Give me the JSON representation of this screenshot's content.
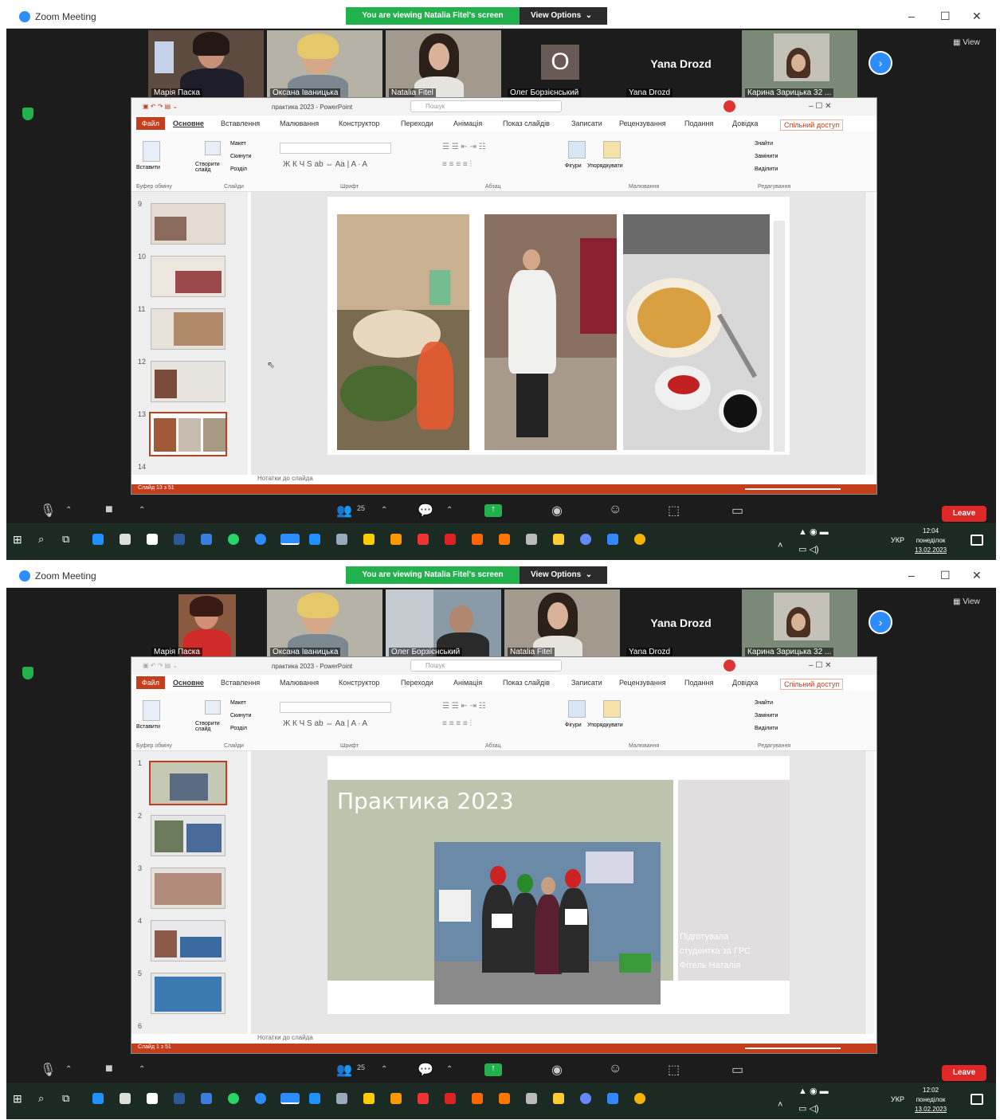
{
  "app_title": "Zoom Meeting",
  "viewing_banner": "You are viewing Natalia Fitel's screen",
  "view_options": "View Options",
  "view_button": "View",
  "leave_button": "Leave",
  "screenshots": [
    {
      "participants": [
        {
          "name": "Марія Паска"
        },
        {
          "name": "Оксана Іваницька"
        },
        {
          "name": "Natalia Fitel"
        },
        {
          "name": "Олег Борзієнський",
          "avatar": "О"
        },
        {
          "name": "Yana Drozd",
          "big_name": "Yana Drozd"
        },
        {
          "name": "Карина Зарицька 32 ..."
        }
      ],
      "ppt": {
        "title": "практика 2023 - PowerPoint",
        "search_placeholder": "Пошук",
        "file_tab": "Файл",
        "tabs": [
          "Основне",
          "Вставлення",
          "Малювання",
          "Конструктор",
          "Переходи",
          "Анімація",
          "Показ слайдів",
          "Записати",
          "Рецензування",
          "Подання",
          "Довідка"
        ],
        "share": "Спільний доступ",
        "ribbon_groups": [
          "Буфер обміну",
          "Слайди",
          "Шрифт",
          "Абзац",
          "Малювання",
          "Редагування"
        ],
        "ribbon_buttons": {
          "paste": "Вставити",
          "new_slide": "Створити слайд",
          "layout": "Макет",
          "reset": "Скинути",
          "section": "Розділ",
          "shapes": "Фігури",
          "arrange": "Упорядкувати",
          "find": "Знайти",
          "replace": "Замінити",
          "select": "Виділити"
        },
        "slide_numbers": [
          "9",
          "10",
          "11",
          "12",
          "13",
          "14"
        ],
        "selected_index": 4,
        "notes_placeholder": "Нотатки до слайда",
        "status_left": "Слайд 13 з 51"
      },
      "clock": {
        "time": "12:04",
        "day": "понеділок",
        "date": "13.02.2023"
      }
    },
    {
      "participants": [
        {
          "name": "Марія Паска"
        },
        {
          "name": "Оксана Іваницька"
        },
        {
          "name": "Олег Борзієнський"
        },
        {
          "name": "Natalia Fitel"
        },
        {
          "name": "Yana Drozd",
          "big_name": "Yana Drozd"
        },
        {
          "name": "Карина Зарицька 32 ..."
        }
      ],
      "ppt": {
        "title": "практика 2023 - PowerPoint",
        "search_placeholder": "Пошук",
        "file_tab": "Файл",
        "tabs": [
          "Основне",
          "Вставлення",
          "Малювання",
          "Конструктор",
          "Переходи",
          "Анімація",
          "Показ слайдів",
          "Записати",
          "Рецензування",
          "Подання",
          "Довідка"
        ],
        "share": "Спільний доступ",
        "ribbon_groups": [
          "Буфер обміну",
          "Слайди",
          "Шрифт",
          "Абзац",
          "Малювання",
          "Редагування"
        ],
        "ribbon_buttons": {
          "paste": "Вставити",
          "new_slide": "Створити слайд",
          "layout": "Макет",
          "reset": "Скинути",
          "section": "Розділ",
          "shapes": "Фігури",
          "arrange": "Упорядкувати",
          "find": "Знайти",
          "replace": "Замінити",
          "select": "Виділити"
        },
        "slide_numbers": [
          "1",
          "2",
          "3",
          "4",
          "5",
          "6"
        ],
        "selected_index": 0,
        "slide_title": "Практика 2023",
        "slide_subtitle_lines": [
          "Підготувала",
          "студентка за ГРС",
          "Фітель Наталія"
        ],
        "notes_placeholder": "Нотатки до слайда",
        "status_left": "Слайд 1 з 51"
      },
      "clock": {
        "time": "12:02",
        "day": "понеділок",
        "date": "13.02.2023"
      }
    }
  ],
  "participant_count": "25",
  "tray_lang": "УКР"
}
